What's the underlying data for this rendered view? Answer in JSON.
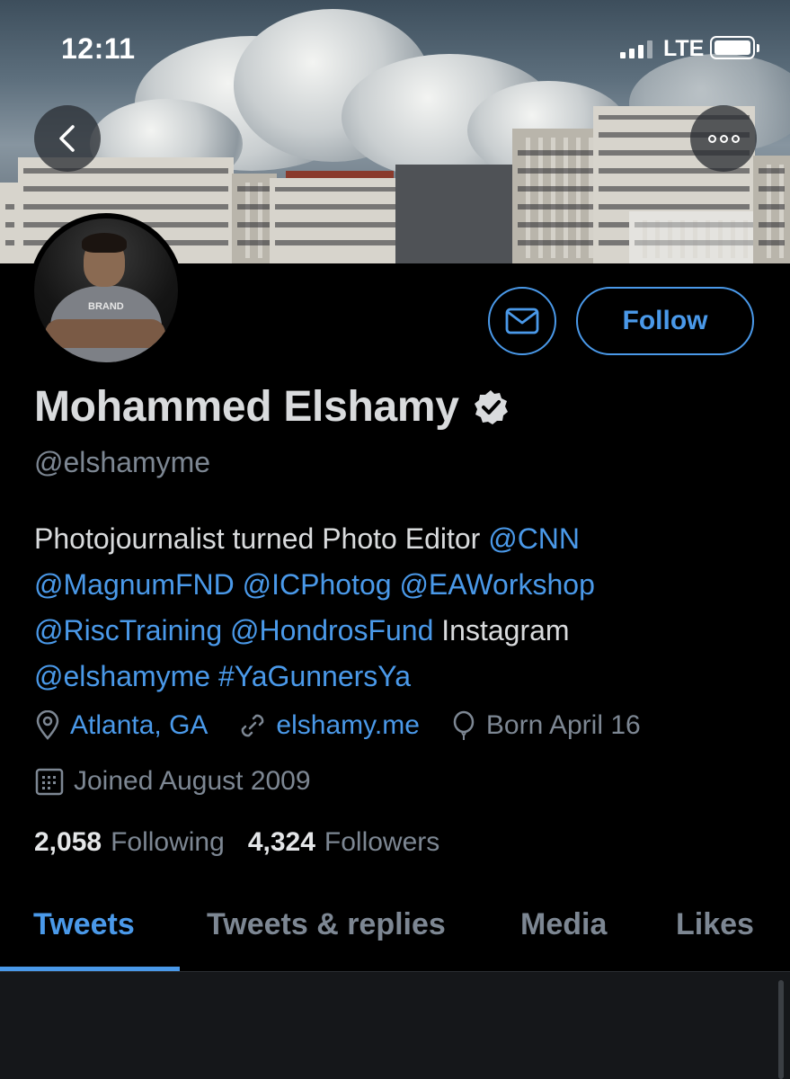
{
  "status_bar": {
    "time": "12:11",
    "network": "LTE"
  },
  "header": {
    "back_icon": "chevron-left-icon",
    "more_icon": "more-horizontal-icon"
  },
  "profile": {
    "name": "Mohammed Elshamy",
    "handle": "@elshamyme",
    "verified": true,
    "avatar_shirt_text": "BRAND",
    "bio": {
      "line1_text": "Photojournalist turned Photo Editor ",
      "line1_link": "@CNN",
      "line2_links": [
        "@MagnumFND",
        "@ICPhotog",
        "@EAWorkshop"
      ],
      "line3_links": [
        "@RiscTraining",
        "@HondrosFund"
      ],
      "line3_text": " Instagram",
      "line4_links": [
        "@elshamyme",
        "#YaGunnersYa"
      ]
    },
    "location": "Atlanta, GA",
    "website": "elshamy.me",
    "birthday": "Born April 16",
    "joined": "Joined August 2009",
    "following_count": "2,058",
    "following_label": "Following",
    "followers_count": "4,324",
    "followers_label": "Followers"
  },
  "actions": {
    "message_icon": "envelope-icon",
    "follow_label": "Follow"
  },
  "tabs": [
    {
      "label": "Tweets",
      "active": true
    },
    {
      "label": "Tweets & replies",
      "active": false
    },
    {
      "label": "Media",
      "active": false
    },
    {
      "label": "Likes",
      "active": false
    }
  ],
  "colors": {
    "accent": "#4a99e9",
    "background": "#000000",
    "secondary_text": "#7d8793"
  }
}
